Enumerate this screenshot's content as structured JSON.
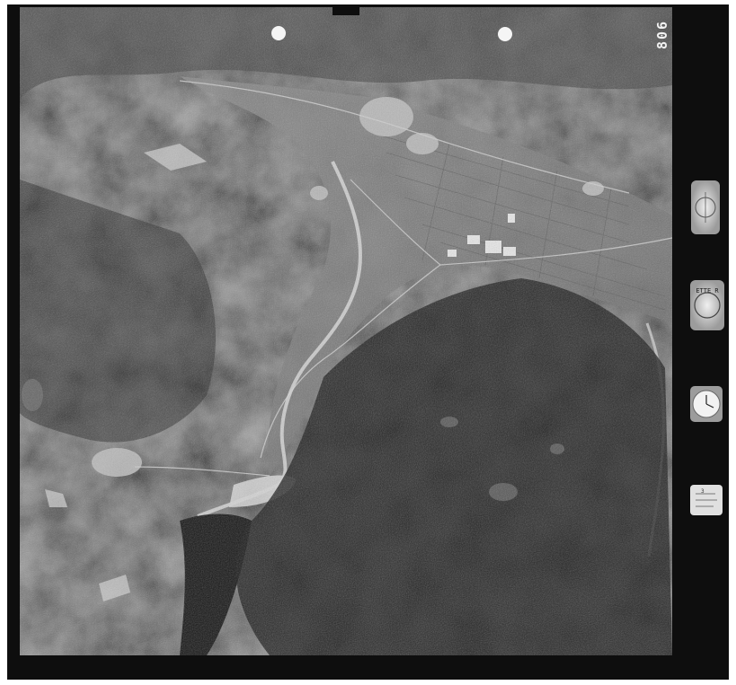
{
  "photo": {
    "frame_number": "806",
    "altimeter_text": "ETTE R",
    "counter_text": "3"
  },
  "colors": {
    "film_border": "#0e0e0e",
    "paper": "#ffffff",
    "terrain_dark": "#1c1c1c",
    "terrain_mid": "#454545",
    "valley_floor": "#7d7d7d",
    "river": "#d8d8d8",
    "instrument_face": "#cfcfcf"
  },
  "icons": [
    "fiducial-mark-icon",
    "level-bubble-icon",
    "altimeter-icon",
    "clock-icon",
    "data-card-icon"
  ]
}
